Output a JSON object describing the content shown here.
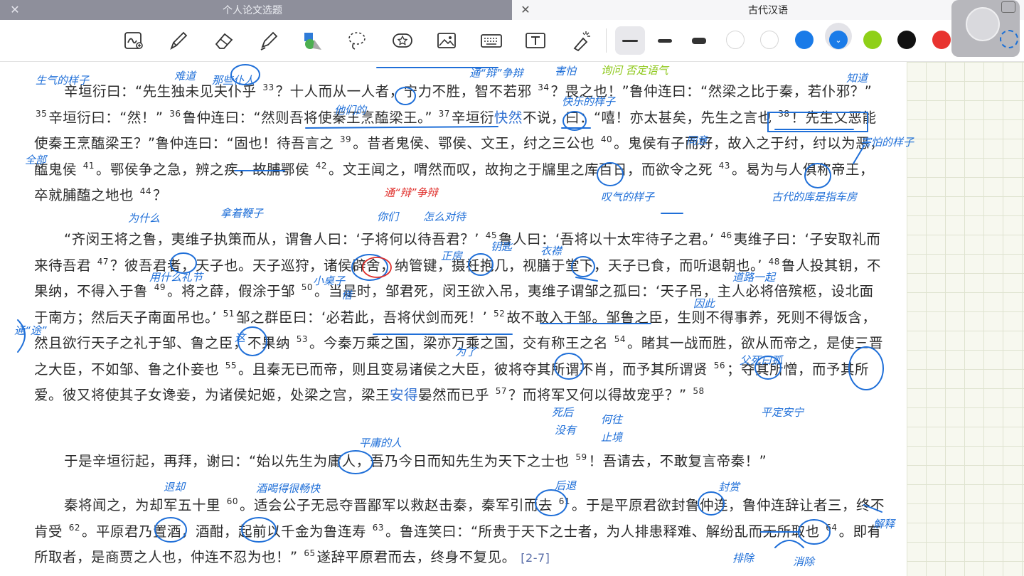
{
  "tabs": [
    {
      "title": "个人论文选题",
      "active": false
    },
    {
      "title": "古代汉语",
      "active": true
    }
  ],
  "toolbar": {
    "tools": [
      "lasso-handwriting-icon",
      "pen-icon",
      "eraser-icon",
      "highlighter-icon",
      "shapes-icon",
      "lasso-icon",
      "sticker-icon",
      "image-icon",
      "keyboard-icon",
      "text-box-icon",
      "laser-pointer-icon"
    ],
    "pen_sizes": [
      "thin",
      "medium",
      "thick"
    ],
    "selected_pen_size": "thin",
    "colors": [
      "#ffffff",
      "#ffffff",
      "#1a7be8",
      "#1a7be8",
      "#8fd018",
      "#111111",
      "#e8332f"
    ],
    "selected_color": "#1a7be8"
  },
  "document": {
    "paragraphs": [
      {
        "text_lines": [
          "辛垣衍曰：“先生独未见夫仆乎 ",
          "？十人而从一人者，宁力不胜，智不若邪 ",
          "？畏之也！”鲁仲连曰：“然梁之比于秦，若仆邪？” ",
          "辛垣衍曰：“然！” ",
          "鲁仲连曰：“然则吾将使秦王烹醢梁王。” ",
          "辛垣衍",
          "快然",
          "不说，曰：“嘻！亦太甚矣，先生之言也 ",
          "！先生又恶能使秦王烹醢梁王？”鲁仲连曰：“固也！待吾言之 ",
          "。昔者鬼侯、鄂侯、文王，纣之三公也 ",
          "。鬼侯有子而好，故入之于纣，纣以为恶，醢鬼侯 ",
          "。鄂侯争之急，辨之疾，故脯鄂侯 ",
          "。文王闻之，喟然而叹，故拘之于牖里之库百日，而欲令之死 ",
          "。曷为与人俱称帝王，卒就脯醢之地也 ",
          "？"
        ],
        "notes": [
          "33",
          "34",
          "35",
          "36",
          "37",
          "38",
          "39",
          "40",
          "41",
          "42",
          "43",
          "44"
        ]
      },
      {
        "text_lines": [
          "“齐闵王将之鲁，夷维子执策而从，谓鲁人曰：‘子将何以待吾君？’ ",
          "鲁人曰：‘吾将以十太牢待子之君。’ ",
          "夷维子曰：‘子安取礼而来待吾君 ",
          "？彼吾君者，天子也。天子巡狩，诸侯辟舍，纳管键，摄衽抱几，视膳于堂下，天子已食，而听退朝也。’ ",
          "鲁人投其钥，不果纳，不得入于鲁 ",
          "。将之薛，假涂于邹 ",
          "。当是时，邹君死，闵王欲入吊，夷维子谓邹之孤曰：‘天子吊，主人必将倍殡柩，设北面于南方；然后天子南面吊也。’ ",
          "邹之群臣曰：‘必若此，吾将伏剑而死！’ ",
          "故不敢入于邹。邹鲁之臣，生则不得事养，死则不得饭含，然且欲行天子之礼于邹、鲁之臣，不果纳 ",
          "。今秦万乘之国，梁亦万乘之国，交有称王之名 ",
          "。睹其一战而胜，欲从而帝之，是使三晋之大臣，不如邹、鲁之仆妾也 ",
          "。且秦无已而帝，则且变易诸侯之大臣，彼将夺其所谓不肖，而予其所谓贤 ",
          "；夺其所憎，而予其所爱。彼又将使其子女谗妾，为诸侯妃姬，处梁之宫，梁王",
          "安得",
          "晏然而已乎 ",
          "？而将军又何以得故宠乎？” "
        ],
        "notes": [
          "45",
          "46",
          "47",
          "48",
          "49",
          "50",
          "51",
          "52",
          "53",
          "54",
          "55",
          "56",
          "57",
          "58"
        ]
      },
      {
        "text_lines": [
          "于是辛垣衍起，再拜，谢曰：“始以先生为庸人，吾乃今日而知先生为天下之士也 ",
          "！吾请去，不敢复言帝秦！”"
        ],
        "notes": [
          "59"
        ]
      },
      {
        "text_lines": [
          "秦将闻之，为却军五十里 ",
          "。适会公子无忌夺晋鄙军以救赵击秦，秦军引而去 ",
          "。于是平原君欲封鲁仲连，鲁仲连辞让者三，终不肯受 ",
          "。平原君乃置酒，酒酣，起前以千金为鲁连寿 ",
          "。鲁连笑曰：“所贵于天下之士者，为人排患释难、解纷乱而无所取也 ",
          "。即有所取者，是商贾之人也，仲连不忍为也！” ",
          "遂辞平原君而去，终身不复见。 "
        ],
        "notes": [
          "60",
          "61",
          "62",
          "63",
          "64",
          "65"
        ],
        "source_ref": "[2-7]"
      }
    ]
  },
  "annotations": {
    "handwritten_notes": [
      "生气的样子",
      "难道",
      "那些仆人",
      "他们的",
      "害怕",
      "知道",
      "同意",
      "快乐的样子",
      "害怕的样子",
      "通“辩”争辩",
      "叹气的样子",
      "古代的库是指车房",
      "为什么",
      "拿着鞭子",
      "这",
      "全部",
      "你们",
      "怎么对待",
      "用什么礼节",
      "正房",
      "钥匙",
      "衣襟",
      "小桌子",
      "借",
      "通“途”",
      "道路",
      "一起",
      "父死曰孤",
      "死后",
      "没有",
      "止境",
      "何往",
      "平定安宁",
      "平庸的人",
      "退却",
      "酒喝得很畅快",
      "后退",
      "封赏",
      "排除",
      "消除",
      "解释",
      "为了",
      "因此"
    ]
  }
}
